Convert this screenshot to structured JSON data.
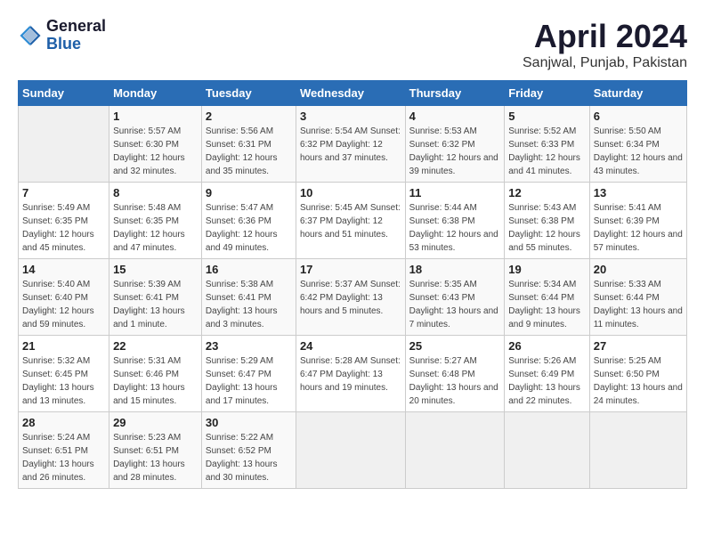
{
  "header": {
    "logo_general": "General",
    "logo_blue": "Blue",
    "title": "April 2024",
    "subtitle": "Sanjwal, Punjab, Pakistan"
  },
  "calendar": {
    "columns": [
      "Sunday",
      "Monday",
      "Tuesday",
      "Wednesday",
      "Thursday",
      "Friday",
      "Saturday"
    ],
    "weeks": [
      [
        {
          "num": "",
          "detail": ""
        },
        {
          "num": "1",
          "detail": "Sunrise: 5:57 AM\nSunset: 6:30 PM\nDaylight: 12 hours\nand 32 minutes."
        },
        {
          "num": "2",
          "detail": "Sunrise: 5:56 AM\nSunset: 6:31 PM\nDaylight: 12 hours\nand 35 minutes."
        },
        {
          "num": "3",
          "detail": "Sunrise: 5:54 AM\nSunset: 6:32 PM\nDaylight: 12 hours\nand 37 minutes."
        },
        {
          "num": "4",
          "detail": "Sunrise: 5:53 AM\nSunset: 6:32 PM\nDaylight: 12 hours\nand 39 minutes."
        },
        {
          "num": "5",
          "detail": "Sunrise: 5:52 AM\nSunset: 6:33 PM\nDaylight: 12 hours\nand 41 minutes."
        },
        {
          "num": "6",
          "detail": "Sunrise: 5:50 AM\nSunset: 6:34 PM\nDaylight: 12 hours\nand 43 minutes."
        }
      ],
      [
        {
          "num": "7",
          "detail": "Sunrise: 5:49 AM\nSunset: 6:35 PM\nDaylight: 12 hours\nand 45 minutes."
        },
        {
          "num": "8",
          "detail": "Sunrise: 5:48 AM\nSunset: 6:35 PM\nDaylight: 12 hours\nand 47 minutes."
        },
        {
          "num": "9",
          "detail": "Sunrise: 5:47 AM\nSunset: 6:36 PM\nDaylight: 12 hours\nand 49 minutes."
        },
        {
          "num": "10",
          "detail": "Sunrise: 5:45 AM\nSunset: 6:37 PM\nDaylight: 12 hours\nand 51 minutes."
        },
        {
          "num": "11",
          "detail": "Sunrise: 5:44 AM\nSunset: 6:38 PM\nDaylight: 12 hours\nand 53 minutes."
        },
        {
          "num": "12",
          "detail": "Sunrise: 5:43 AM\nSunset: 6:38 PM\nDaylight: 12 hours\nand 55 minutes."
        },
        {
          "num": "13",
          "detail": "Sunrise: 5:41 AM\nSunset: 6:39 PM\nDaylight: 12 hours\nand 57 minutes."
        }
      ],
      [
        {
          "num": "14",
          "detail": "Sunrise: 5:40 AM\nSunset: 6:40 PM\nDaylight: 12 hours\nand 59 minutes."
        },
        {
          "num": "15",
          "detail": "Sunrise: 5:39 AM\nSunset: 6:41 PM\nDaylight: 13 hours\nand 1 minute."
        },
        {
          "num": "16",
          "detail": "Sunrise: 5:38 AM\nSunset: 6:41 PM\nDaylight: 13 hours\nand 3 minutes."
        },
        {
          "num": "17",
          "detail": "Sunrise: 5:37 AM\nSunset: 6:42 PM\nDaylight: 13 hours\nand 5 minutes."
        },
        {
          "num": "18",
          "detail": "Sunrise: 5:35 AM\nSunset: 6:43 PM\nDaylight: 13 hours\nand 7 minutes."
        },
        {
          "num": "19",
          "detail": "Sunrise: 5:34 AM\nSunset: 6:44 PM\nDaylight: 13 hours\nand 9 minutes."
        },
        {
          "num": "20",
          "detail": "Sunrise: 5:33 AM\nSunset: 6:44 PM\nDaylight: 13 hours\nand 11 minutes."
        }
      ],
      [
        {
          "num": "21",
          "detail": "Sunrise: 5:32 AM\nSunset: 6:45 PM\nDaylight: 13 hours\nand 13 minutes."
        },
        {
          "num": "22",
          "detail": "Sunrise: 5:31 AM\nSunset: 6:46 PM\nDaylight: 13 hours\nand 15 minutes."
        },
        {
          "num": "23",
          "detail": "Sunrise: 5:29 AM\nSunset: 6:47 PM\nDaylight: 13 hours\nand 17 minutes."
        },
        {
          "num": "24",
          "detail": "Sunrise: 5:28 AM\nSunset: 6:47 PM\nDaylight: 13 hours\nand 19 minutes."
        },
        {
          "num": "25",
          "detail": "Sunrise: 5:27 AM\nSunset: 6:48 PM\nDaylight: 13 hours\nand 20 minutes."
        },
        {
          "num": "26",
          "detail": "Sunrise: 5:26 AM\nSunset: 6:49 PM\nDaylight: 13 hours\nand 22 minutes."
        },
        {
          "num": "27",
          "detail": "Sunrise: 5:25 AM\nSunset: 6:50 PM\nDaylight: 13 hours\nand 24 minutes."
        }
      ],
      [
        {
          "num": "28",
          "detail": "Sunrise: 5:24 AM\nSunset: 6:51 PM\nDaylight: 13 hours\nand 26 minutes."
        },
        {
          "num": "29",
          "detail": "Sunrise: 5:23 AM\nSunset: 6:51 PM\nDaylight: 13 hours\nand 28 minutes."
        },
        {
          "num": "30",
          "detail": "Sunrise: 5:22 AM\nSunset: 6:52 PM\nDaylight: 13 hours\nand 30 minutes."
        },
        {
          "num": "",
          "detail": ""
        },
        {
          "num": "",
          "detail": ""
        },
        {
          "num": "",
          "detail": ""
        },
        {
          "num": "",
          "detail": ""
        }
      ]
    ]
  }
}
